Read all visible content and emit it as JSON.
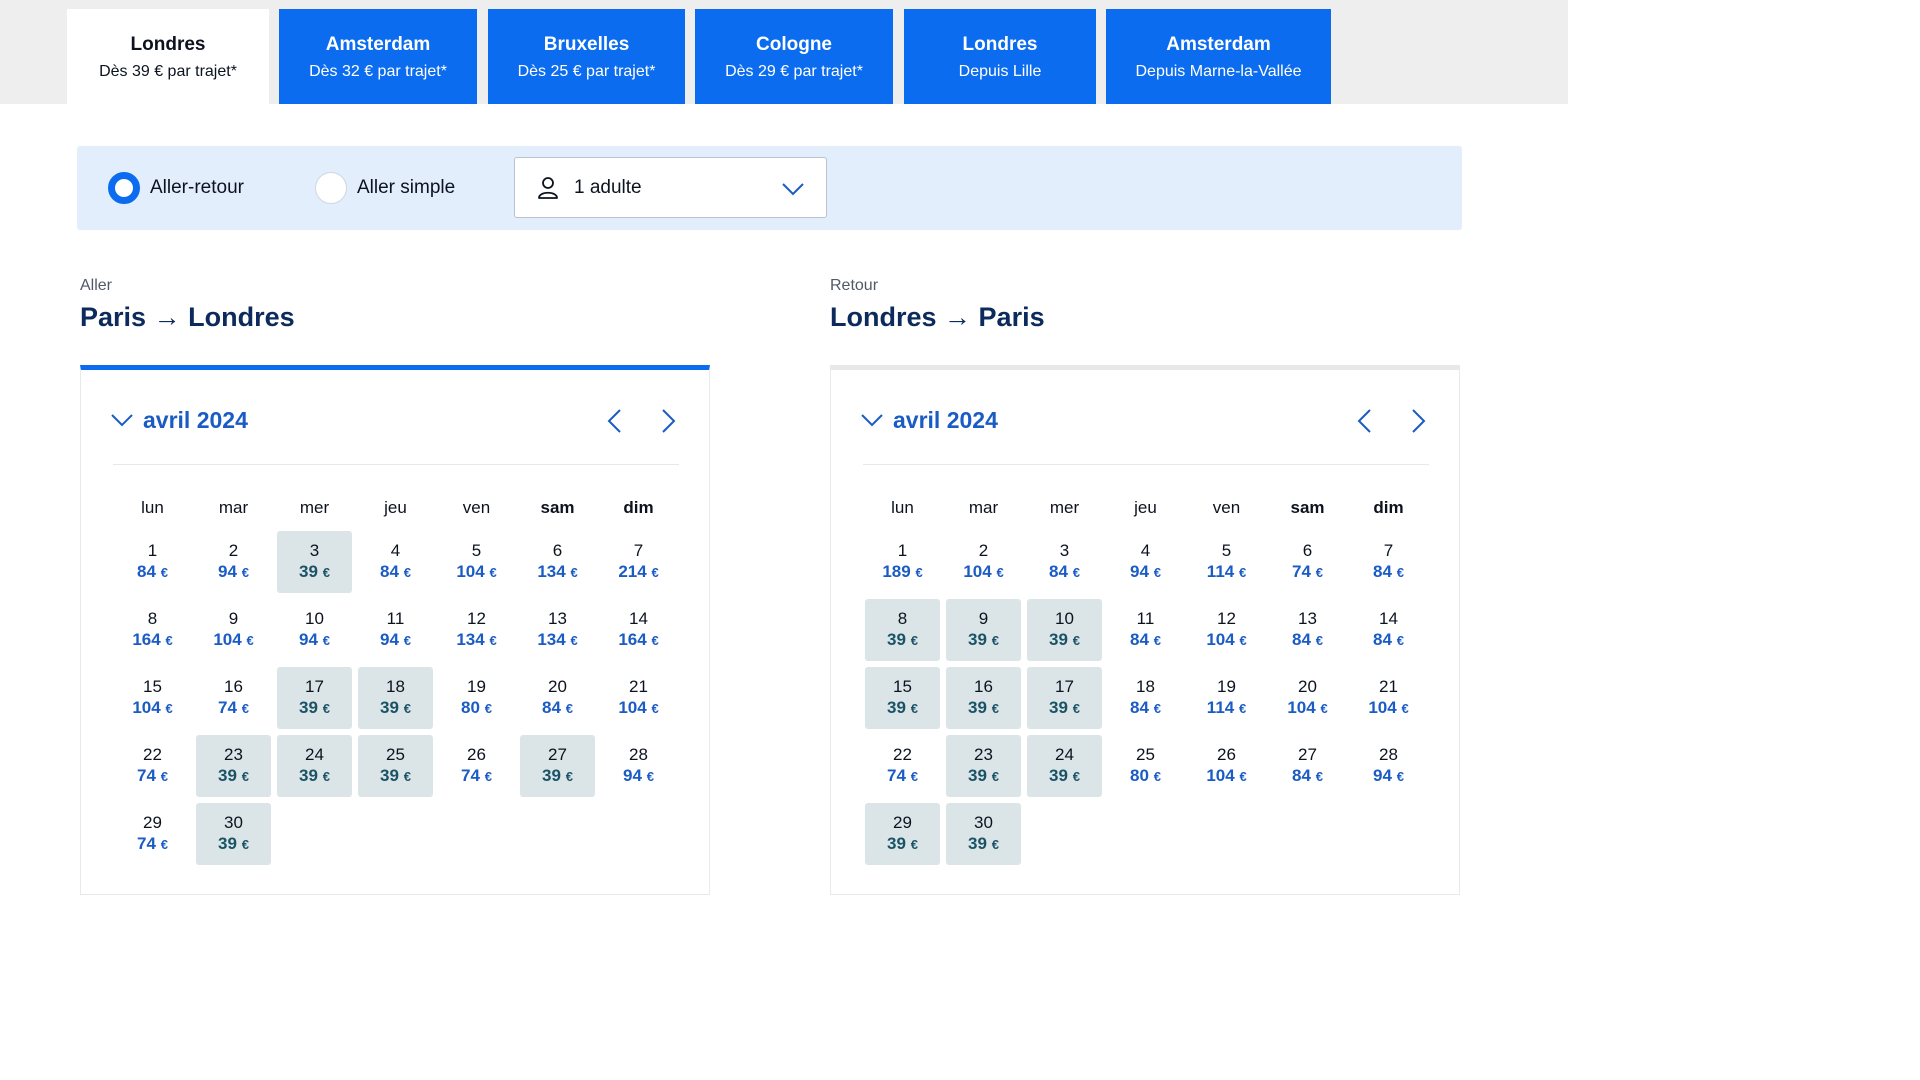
{
  "tabs": [
    {
      "title": "Londres",
      "subtitle": "Dès 39  € par trajet*",
      "active": true
    },
    {
      "title": "Amsterdam",
      "subtitle": "Dès 32 € par trajet*",
      "active": false
    },
    {
      "title": "Bruxelles",
      "subtitle": "Dès 25 € par trajet*",
      "active": false
    },
    {
      "title": "Cologne",
      "subtitle": "Dès 29 € par trajet*",
      "active": false
    },
    {
      "title": "Londres",
      "subtitle": "Depuis Lille",
      "active": false
    },
    {
      "title": "Amsterdam",
      "subtitle": "Depuis Marne-la-Vallée",
      "active": false
    }
  ],
  "options": {
    "round_trip_label": "Aller-retour",
    "one_way_label": "Aller simple",
    "selected": "round_trip",
    "passengers": "1 adulte",
    "passenger_icon": "user-icon",
    "dropdown_icon": "chevron-down-icon"
  },
  "colors": {
    "accent": "#0c6cf0",
    "price_blue": "#1a5bc4",
    "low_price_bg": "#dbe5e8",
    "low_price_text": "#1a5366",
    "options_bg": "#e3eefd"
  },
  "weekdays": [
    "lun",
    "mar",
    "mer",
    "jeu",
    "ven",
    "sam",
    "dim"
  ],
  "weekend_bold": [
    "sam",
    "dim"
  ],
  "currency": "€",
  "legs": [
    {
      "id": "outbound",
      "label": "Aller",
      "from": "Paris",
      "to": "Londres",
      "month": "avril 2024",
      "active": true,
      "days": [
        {
          "d": "1",
          "p": "84",
          "low": false
        },
        {
          "d": "2",
          "p": "94",
          "low": false
        },
        {
          "d": "3",
          "p": "39",
          "low": true
        },
        {
          "d": "4",
          "p": "84",
          "low": false
        },
        {
          "d": "5",
          "p": "104",
          "low": false
        },
        {
          "d": "6",
          "p": "134",
          "low": false
        },
        {
          "d": "7",
          "p": "214",
          "low": false
        },
        {
          "d": "8",
          "p": "164",
          "low": false
        },
        {
          "d": "9",
          "p": "104",
          "low": false
        },
        {
          "d": "10",
          "p": "94",
          "low": false
        },
        {
          "d": "11",
          "p": "94",
          "low": false
        },
        {
          "d": "12",
          "p": "134",
          "low": false
        },
        {
          "d": "13",
          "p": "134",
          "low": false
        },
        {
          "d": "14",
          "p": "164",
          "low": false
        },
        {
          "d": "15",
          "p": "104",
          "low": false
        },
        {
          "d": "16",
          "p": "74",
          "low": false
        },
        {
          "d": "17",
          "p": "39",
          "low": true
        },
        {
          "d": "18",
          "p": "39",
          "low": true
        },
        {
          "d": "19",
          "p": "80",
          "low": false
        },
        {
          "d": "20",
          "p": "84",
          "low": false
        },
        {
          "d": "21",
          "p": "104",
          "low": false
        },
        {
          "d": "22",
          "p": "74",
          "low": false
        },
        {
          "d": "23",
          "p": "39",
          "low": true
        },
        {
          "d": "24",
          "p": "39",
          "low": true
        },
        {
          "d": "25",
          "p": "39",
          "low": true
        },
        {
          "d": "26",
          "p": "74",
          "low": false
        },
        {
          "d": "27",
          "p": "39",
          "low": true
        },
        {
          "d": "28",
          "p": "94",
          "low": false
        },
        {
          "d": "29",
          "p": "74",
          "low": false
        },
        {
          "d": "30",
          "p": "39",
          "low": true
        }
      ]
    },
    {
      "id": "return",
      "label": "Retour",
      "from": "Londres",
      "to": "Paris",
      "month": "avril 2024",
      "active": false,
      "days": [
        {
          "d": "1",
          "p": "189",
          "low": false
        },
        {
          "d": "2",
          "p": "104",
          "low": false
        },
        {
          "d": "3",
          "p": "84",
          "low": false
        },
        {
          "d": "4",
          "p": "94",
          "low": false
        },
        {
          "d": "5",
          "p": "114",
          "low": false
        },
        {
          "d": "6",
          "p": "74",
          "low": false
        },
        {
          "d": "7",
          "p": "84",
          "low": false
        },
        {
          "d": "8",
          "p": "39",
          "low": true
        },
        {
          "d": "9",
          "p": "39",
          "low": true
        },
        {
          "d": "10",
          "p": "39",
          "low": true
        },
        {
          "d": "11",
          "p": "84",
          "low": false
        },
        {
          "d": "12",
          "p": "104",
          "low": false
        },
        {
          "d": "13",
          "p": "84",
          "low": false
        },
        {
          "d": "14",
          "p": "84",
          "low": false
        },
        {
          "d": "15",
          "p": "39",
          "low": true
        },
        {
          "d": "16",
          "p": "39",
          "low": true
        },
        {
          "d": "17",
          "p": "39",
          "low": true
        },
        {
          "d": "18",
          "p": "84",
          "low": false
        },
        {
          "d": "19",
          "p": "114",
          "low": false
        },
        {
          "d": "20",
          "p": "104",
          "low": false
        },
        {
          "d": "21",
          "p": "104",
          "low": false
        },
        {
          "d": "22",
          "p": "74",
          "low": false
        },
        {
          "d": "23",
          "p": "39",
          "low": true
        },
        {
          "d": "24",
          "p": "39",
          "low": true
        },
        {
          "d": "25",
          "p": "80",
          "low": false
        },
        {
          "d": "26",
          "p": "104",
          "low": false
        },
        {
          "d": "27",
          "p": "84",
          "low": false
        },
        {
          "d": "28",
          "p": "94",
          "low": false
        },
        {
          "d": "29",
          "p": "39",
          "low": true
        },
        {
          "d": "30",
          "p": "39",
          "low": true
        }
      ]
    }
  ]
}
